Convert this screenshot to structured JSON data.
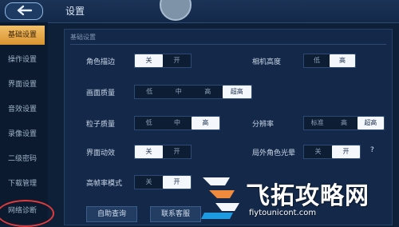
{
  "topbar": {
    "title": "设置"
  },
  "sidebar": {
    "items": [
      {
        "label": "基础设置",
        "active": true
      },
      {
        "label": "操作设置"
      },
      {
        "label": "界面设置"
      },
      {
        "label": "音效设置"
      },
      {
        "label": "录像设置"
      },
      {
        "label": "二级密码"
      },
      {
        "label": "下载管理"
      },
      {
        "label": "网络诊断",
        "highlighted": true
      }
    ]
  },
  "settings": {
    "section_title": "基础设置",
    "role_outline": {
      "label": "角色描边",
      "options": [
        "关",
        "开"
      ],
      "selected": "关"
    },
    "camera_height": {
      "label": "相机高度",
      "options": [
        "低",
        "高"
      ],
      "selected": "高"
    },
    "image_quality": {
      "label": "画面质量",
      "options": [
        "低",
        "中",
        "高",
        "超高"
      ],
      "selected": "超高"
    },
    "particle_quality": {
      "label": "粒子质量",
      "options": [
        "低",
        "中",
        "高"
      ],
      "selected": "高"
    },
    "resolution": {
      "label": "分辨率",
      "options": [
        "标准",
        "高",
        "超高"
      ],
      "selected": "超高"
    },
    "ui_animation": {
      "label": "界面动效",
      "options": [
        "关",
        "开"
      ],
      "selected": "关"
    },
    "outside_role_halo": {
      "label": "局外角色光晕",
      "options": [
        "关",
        "开"
      ],
      "selected": "开",
      "help": "?"
    },
    "high_fps_mode": {
      "label": "高帧率模式",
      "options": [
        "关",
        "开"
      ],
      "selected": "开"
    }
  },
  "bottom_buttons": {
    "auto_query": "自助查询",
    "contact_service": "联系客服"
  },
  "watermark": {
    "brand": "飞拓攻略网",
    "url": "fiytounicont.com"
  },
  "colors": {
    "accent": "#e6a84a",
    "highlight_ring": "#e23b3b",
    "background": "#0e2038"
  }
}
